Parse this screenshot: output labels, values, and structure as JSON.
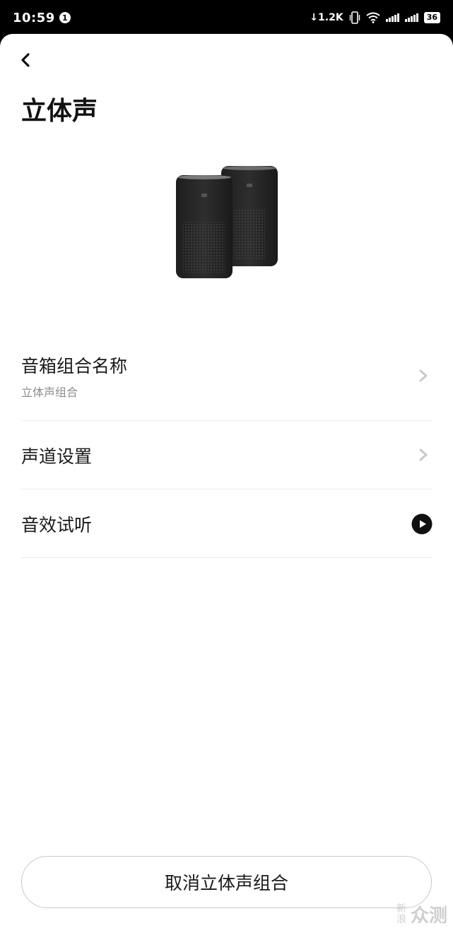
{
  "status_bar": {
    "time": "10:59",
    "notification_badge": "1",
    "net_speed": "↓1.2K",
    "battery": "36",
    "icons": [
      "download-icon",
      "vibrate-icon",
      "wifi-icon",
      "signal-icon",
      "signal-icon",
      "battery-icon"
    ]
  },
  "header": {
    "back_icon": "chevron-left-icon",
    "title": "立体声"
  },
  "product_image": "smart-speaker-pair",
  "settings": [
    {
      "title": "音箱组合名称",
      "subtitle": "立体声组合",
      "action_icon": "chevron-right-icon"
    },
    {
      "title": "声道设置",
      "action_icon": "chevron-right-icon"
    },
    {
      "title": "音效试听",
      "action_icon": "play-icon"
    }
  ],
  "footer": {
    "cancel_label": "取消立体声组合"
  },
  "watermark": {
    "small": "新浪",
    "big": "众测"
  },
  "colors": {
    "background": "#ffffff",
    "status_bar": "#000000",
    "chevron": "#c7c9d1",
    "play_button": "#111111"
  }
}
